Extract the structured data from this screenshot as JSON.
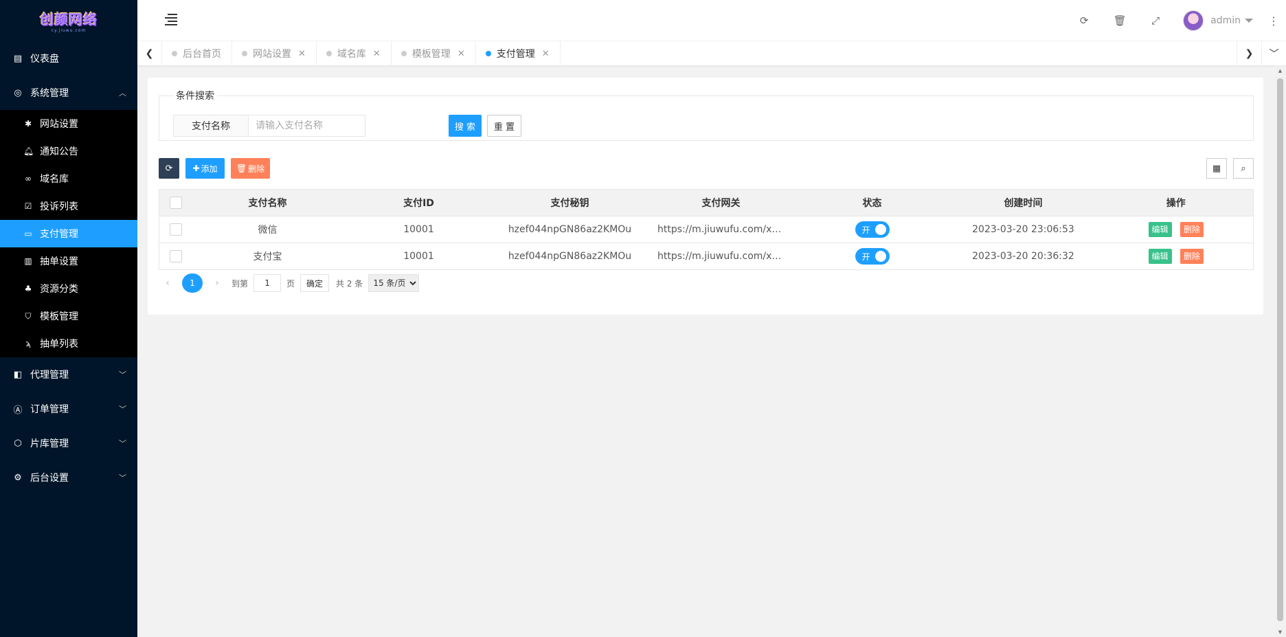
{
  "brand": {
    "logo_text": "创颜网络",
    "logo_sub": "cy.jiuwu.com"
  },
  "sidebar": {
    "items": [
      {
        "label": "仪表盘",
        "icon": "dashboard-icon"
      },
      {
        "label": "系统管理",
        "icon": "gear-icon",
        "expanded": true
      },
      {
        "label": "代理管理",
        "icon": "agent-icon"
      },
      {
        "label": "订单管理",
        "icon": "order-icon"
      },
      {
        "label": "片库管理",
        "icon": "library-icon"
      },
      {
        "label": "后台设置",
        "icon": "settings-icon"
      }
    ],
    "submenu": [
      {
        "label": "网站设置",
        "icon": "asterisk-icon"
      },
      {
        "label": "通知公告",
        "icon": "bell-icon"
      },
      {
        "label": "域名库",
        "icon": "link-icon"
      },
      {
        "label": "投诉列表",
        "icon": "check-square-icon"
      },
      {
        "label": "支付管理",
        "icon": "wallet-icon",
        "active": true
      },
      {
        "label": "抽单设置",
        "icon": "bars-icon"
      },
      {
        "label": "资源分类",
        "icon": "category-icon"
      },
      {
        "label": "模板管理",
        "icon": "html5-icon"
      },
      {
        "label": "抽单列表",
        "icon": "list-icon"
      }
    ]
  },
  "header": {
    "user": "admin"
  },
  "tabs": [
    {
      "label": "后台首页",
      "closable": false
    },
    {
      "label": "网站设置",
      "closable": true
    },
    {
      "label": "域名库",
      "closable": true
    },
    {
      "label": "模板管理",
      "closable": true
    },
    {
      "label": "支付管理",
      "closable": true,
      "active": true
    }
  ],
  "search": {
    "legend": "条件搜索",
    "field_label": "支付名称",
    "placeholder": "请输入支付名称",
    "search_btn": "搜 索",
    "reset_btn": "重 置"
  },
  "toolbar": {
    "add": "添加",
    "delete": "删除"
  },
  "table": {
    "columns": [
      "支付名称",
      "支付ID",
      "支付秘钥",
      "支付网关",
      "状态",
      "创建时间",
      "操作"
    ],
    "rows": [
      {
        "name": "微信",
        "id": "10001",
        "key": "hzef044npGN86az2KMOu",
        "gateway": "https://m.jiuwufu.com/xpay/...",
        "status": "开",
        "created": "2023-03-20 23:06:53",
        "edit": "编辑",
        "del": "删除"
      },
      {
        "name": "支付宝",
        "id": "10001",
        "key": "hzef044npGN86az2KMOu",
        "gateway": "https://m.jiuwufu.com/xpay/...",
        "status": "开",
        "created": "2023-03-20 20:36:32",
        "edit": "编辑",
        "del": "删除"
      }
    ]
  },
  "pager": {
    "current": "1",
    "goto_label": "到第",
    "goto_value": "1",
    "page_unit": "页",
    "confirm": "确定",
    "total": "共 2 条",
    "page_size": "15 条/页"
  },
  "colors": {
    "accent": "#1e9fff",
    "sidebar": "#001529",
    "danger": "#ff5722",
    "success": "#16b777"
  }
}
